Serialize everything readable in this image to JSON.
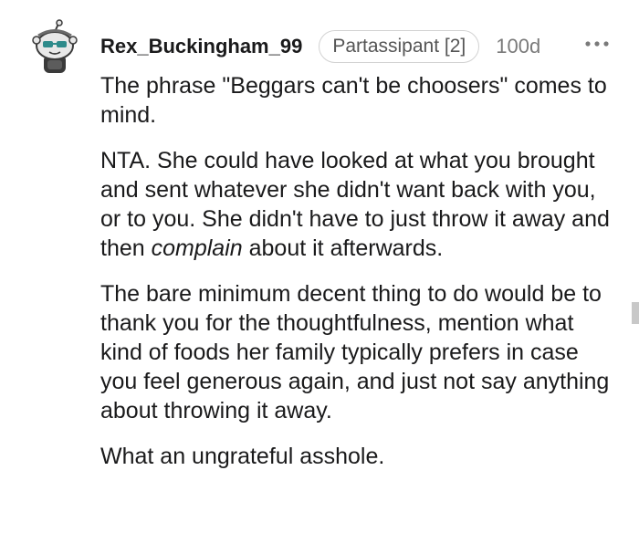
{
  "comment": {
    "username": "Rex_Buckingham_99",
    "flair": "Partassipant [2]",
    "age": "100d",
    "paragraphs": [
      "The phrase \"Beggars can't be choosers\" comes to mind.",
      "NTA. She could have looked at what you brought and sent whatever she didn't want back with you, or to you. She didn't have to just throw it away and then ",
      "complain",
      " about it afterwards.",
      "The bare minimum decent thing to do would be to thank you for the thoughtfulness, mention what kind of foods her family typically prefers in case you feel generous again, and just not say anything about throwing it away.",
      "What an ungrateful asshole."
    ]
  },
  "icons": {
    "avatar": "snoo-avatar-icon",
    "more": "more-options-icon"
  },
  "colors": {
    "text": "#1a1a1b",
    "meta": "#7a7a7a",
    "flair_border": "#d2d2d2"
  }
}
